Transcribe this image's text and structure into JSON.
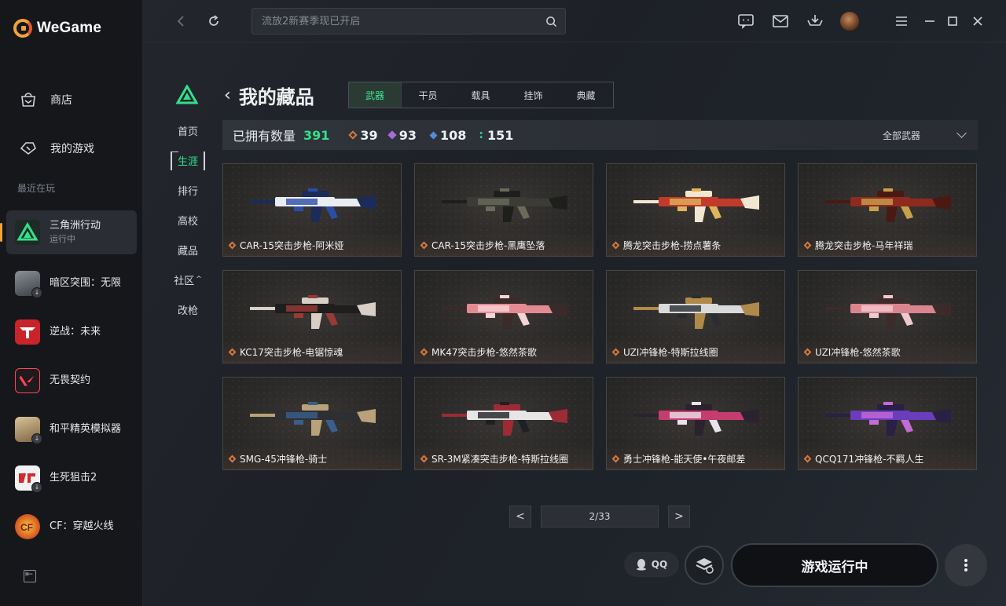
{
  "app": {
    "name": "WeGame"
  },
  "sidebar": {
    "nav": [
      {
        "label": "商店",
        "icon": "shop-bag-icon"
      },
      {
        "label": "我的游戏",
        "icon": "gamepad-icon"
      }
    ],
    "recent_title": "最近在玩",
    "games": [
      {
        "name": "三角洲行动",
        "status": "运行中",
        "active": true
      },
      {
        "name": "暗区突围：无限"
      },
      {
        "name": "逆战：未来"
      },
      {
        "name": "无畏契约"
      },
      {
        "name": "和平精英模拟器"
      },
      {
        "name": "生死狙击2"
      },
      {
        "name": "CF：穿越火线"
      }
    ]
  },
  "topbar": {
    "search_placeholder": "流放2新赛季现已开启"
  },
  "subnav": {
    "items": [
      "首页",
      "生涯",
      "排行",
      "高校",
      "藏品",
      "社区",
      "改枪"
    ],
    "active": "生涯",
    "community_suffix": "^"
  },
  "header": {
    "title": "我的藏品",
    "tabs": [
      "武器",
      "干员",
      "载具",
      "挂饰",
      "典藏"
    ],
    "active_tab": "武器"
  },
  "stats": {
    "owned_label": "已拥有数量",
    "owned_count": "391",
    "rarity": [
      {
        "value": "39",
        "color": "#d4793e"
      },
      {
        "value": "93",
        "color": "#a76bd8"
      },
      {
        "value": "108",
        "color": "#4f8fd9"
      },
      {
        "value": "151",
        "color": "#37c98c"
      }
    ],
    "filter_label": "全部武器"
  },
  "items": [
    {
      "name": "CAR-15突击步枪-阿米娅",
      "palette": [
        "#e9edf3",
        "#2a4ea8",
        "#1b2b5a"
      ]
    },
    {
      "name": "CAR-15突击步枪-黑鹰坠落",
      "palette": [
        "#3b3c36",
        "#6b6a5a",
        "#1e1f1c"
      ]
    },
    {
      "name": "腾龙突击步枪-捞点薯条",
      "palette": [
        "#c23a2a",
        "#e0b45a",
        "#f1e6cf"
      ]
    },
    {
      "name": "腾龙突击步枪-马年祥瑞",
      "palette": [
        "#8e2a1e",
        "#c9a04a",
        "#4a1a12"
      ]
    },
    {
      "name": "KC17突击步枪-电锯惊魂",
      "palette": [
        "#1e1e1e",
        "#9a3a36",
        "#d8d0c6"
      ]
    },
    {
      "name": "MK47突击步枪-悠然茶歌",
      "palette": [
        "#e38a93",
        "#f6d3d6",
        "#3a2a2a"
      ]
    },
    {
      "name": "UZI冲锋枪-特斯拉线圈",
      "palette": [
        "#d8dadc",
        "#2b2d30",
        "#b08a4a"
      ]
    },
    {
      "name": "UZI冲锋枪-悠然茶歌",
      "palette": [
        "#d98590",
        "#f1c8cd",
        "#3d2b2b"
      ]
    },
    {
      "name": "SMG-45冲锋枪-骑士",
      "palette": [
        "#2e2f33",
        "#3a5f8c",
        "#b9a27a"
      ]
    },
    {
      "name": "SR-3M紧凑突击步枪-特斯拉线圈",
      "palette": [
        "#e6e6e6",
        "#1f2023",
        "#9d2b34"
      ]
    },
    {
      "name": "勇士冲锋枪-能天使•午夜邮差",
      "palette": [
        "#c53d6e",
        "#e9e2ea",
        "#2b2230"
      ]
    },
    {
      "name": "QCQ171冲锋枪-不羁人生",
      "palette": [
        "#6a3dbd",
        "#c56ad6",
        "#2a1f45"
      ]
    }
  ],
  "pager": {
    "prev": "<",
    "current": "2/33",
    "next": ">"
  },
  "bottom": {
    "qq_label": "QQ",
    "run_label": "游戏运行中"
  }
}
